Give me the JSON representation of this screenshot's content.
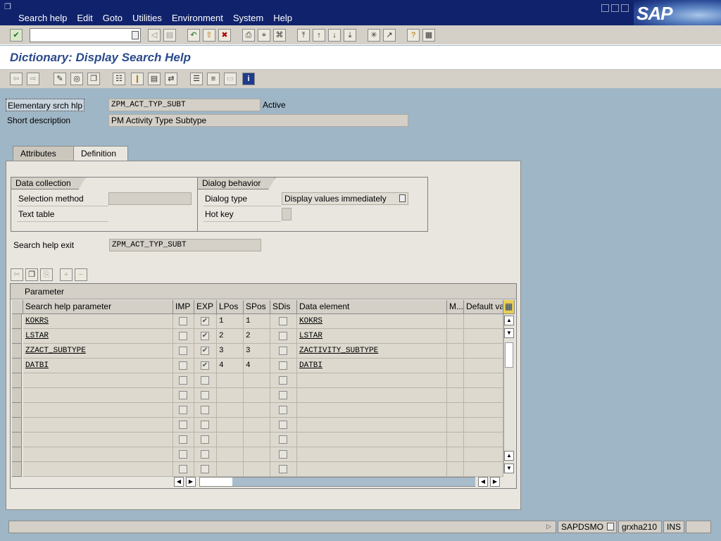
{
  "menubar": {
    "items": [
      "Search help",
      "Edit",
      "Goto",
      "Utilities",
      "Environment",
      "System",
      "Help"
    ],
    "logo": "SAP"
  },
  "stdbar": {
    "command_value": ""
  },
  "title": "Dictionary: Display Search Help",
  "header": {
    "srch_label": "Elementary srch hlp",
    "srch_value": "ZPM_ACT_TYP_SUBT",
    "status": "Active",
    "desc_label": "Short description",
    "desc_value": "PM Activity Type Subtype"
  },
  "tabs": [
    {
      "label": "Attributes",
      "active": false
    },
    {
      "label": "Definition",
      "active": true
    }
  ],
  "data_collection": {
    "title": "Data collection",
    "selection_method_label": "Selection method",
    "selection_method_value": "",
    "text_table_label": "Text table"
  },
  "dialog_behavior": {
    "title": "Dialog behavior",
    "dialog_type_label": "Dialog type",
    "dialog_type_value": "Display values immediately",
    "hot_key_label": "Hot key",
    "hot_key_value": ""
  },
  "exit": {
    "label": "Search help exit",
    "value": "ZPM_ACT_TYP_SUBT"
  },
  "table": {
    "caption": "Parameter",
    "columns": [
      "Search help parameter",
      "IMP",
      "EXP",
      "LPos",
      "SPos",
      "SDis",
      "Data element",
      "M...",
      "Default va"
    ],
    "rows": [
      {
        "param": "KOKRS",
        "imp": false,
        "exp": true,
        "lpos": "1",
        "spos": "1",
        "sdis": false,
        "element": "KOKRS"
      },
      {
        "param": "LSTAR",
        "imp": false,
        "exp": true,
        "lpos": "2",
        "spos": "2",
        "sdis": false,
        "element": "LSTAR"
      },
      {
        "param": "ZZACT_SUBTYPE",
        "imp": false,
        "exp": true,
        "lpos": "3",
        "spos": "3",
        "sdis": false,
        "element": "ZACTIVITY_SUBTYPE"
      },
      {
        "param": "DATBI",
        "imp": false,
        "exp": true,
        "lpos": "4",
        "spos": "4",
        "sdis": false,
        "element": "DATBI"
      }
    ],
    "empty_rows": 7
  },
  "status": {
    "message": "",
    "system": "SAPDSMO",
    "server": "grxha210",
    "mode": "INS"
  }
}
